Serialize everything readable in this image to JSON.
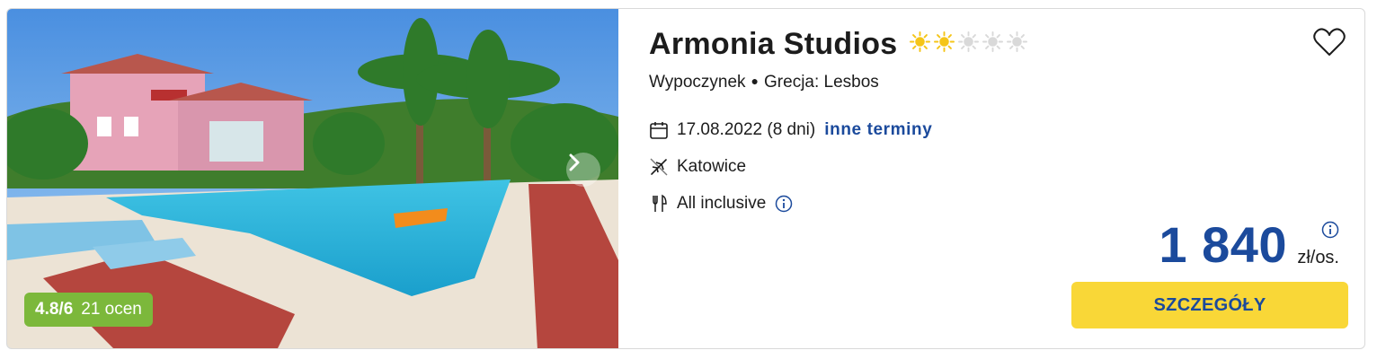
{
  "hotel": {
    "name": "Armonia Studios",
    "stars_filled": 2,
    "stars_total": 5,
    "category": "Wypoczynek",
    "location": "Grecja: Lesbos"
  },
  "rating": {
    "score": "4.8/6",
    "count": "21 ocen"
  },
  "trip": {
    "date": "17.08.2022 (8 dni)",
    "more_dates_label": "inne terminy",
    "departure": "Katowice",
    "board": "All inclusive"
  },
  "price": {
    "amount": "1 840",
    "unit": "zł/os."
  },
  "actions": {
    "details_label": "SZCZEGÓŁY"
  },
  "icons": {
    "photo_next": "chevron-right-icon",
    "favorite": "heart-icon",
    "date": "calendar-icon",
    "departure": "plane-icon",
    "board": "cutlery-icon",
    "info": "info-icon",
    "star": "sun-icon"
  },
  "colors": {
    "brand_blue": "#1b4a9c",
    "button_yellow": "#f9d737",
    "rating_green": "#7cb83b",
    "star_active": "#f5c518",
    "star_inactive": "#d9d9d9"
  }
}
